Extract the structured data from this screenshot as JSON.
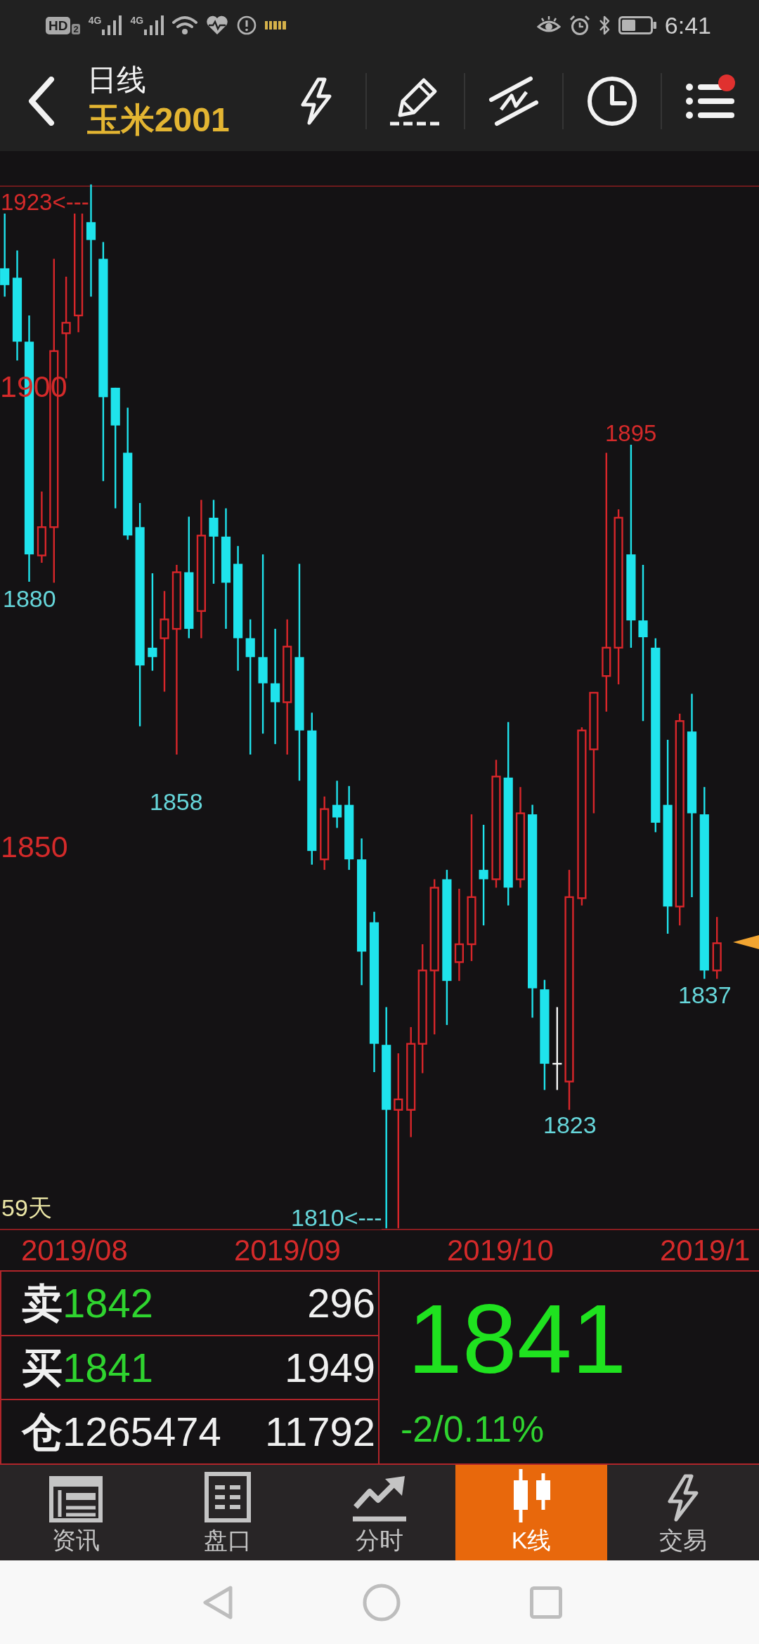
{
  "status_bar": {
    "hd_label": "HD",
    "hd_sub": "2",
    "signals": [
      {
        "network": "4G"
      },
      {
        "network": "4G"
      }
    ],
    "time": "6:41"
  },
  "header": {
    "period": "日线",
    "symbol": "玉米2001",
    "menu_dot": true
  },
  "chart": {
    "annotations": [
      {
        "kind": "high",
        "text": "1923<---"
      },
      {
        "kind": "axis",
        "text": "1900"
      },
      {
        "kind": "high",
        "text": "1895"
      },
      {
        "kind": "low",
        "text": "1880"
      },
      {
        "kind": "low",
        "text": "1858"
      },
      {
        "kind": "axis",
        "text": "1850"
      },
      {
        "kind": "low",
        "text": "1837"
      },
      {
        "kind": "low",
        "text": "1823"
      },
      {
        "kind": "low",
        "text": "1810<---"
      }
    ],
    "bar_count": "59天",
    "dates": [
      "2019/08",
      "2019/09",
      "2019/10",
      "2019/1"
    ]
  },
  "quote": {
    "rows": [
      {
        "kind": "sell",
        "label": "卖",
        "price": "1842",
        "volume": "296"
      },
      {
        "kind": "buy",
        "label": "买",
        "price": "1841",
        "volume": "1949"
      },
      {
        "kind": "open_interest",
        "label": "仓",
        "price": "1265474",
        "volume": "11792"
      }
    ],
    "last": "1841",
    "change": "-2/0.11%"
  },
  "tabs": [
    {
      "label": "资讯",
      "selected": false
    },
    {
      "label": "盘口",
      "selected": false
    },
    {
      "label": "分时",
      "selected": false
    },
    {
      "label": "K线",
      "selected": true
    },
    {
      "label": "交易",
      "selected": false
    }
  ]
}
